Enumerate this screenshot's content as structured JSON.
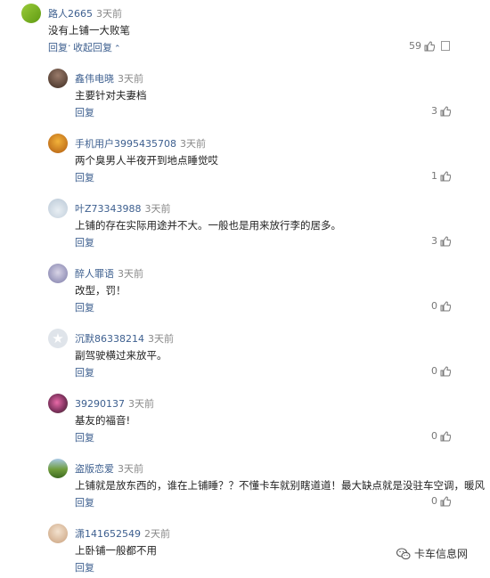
{
  "comments": [
    {
      "user": "路人2665",
      "time": "3天前",
      "text": "没有上铺一大败笔",
      "reply": "回复",
      "sep": "·",
      "collapse": "收起回复",
      "likes": "59"
    },
    {
      "user": "鑫伟电晓",
      "time": "3天前",
      "text": "主要针对夫妻档",
      "reply": "回复",
      "likes": "3"
    },
    {
      "user": "手机用户3995435708",
      "time": "3天前",
      "text": "两个臭男人半夜开到地点睡觉哎",
      "reply": "回复",
      "likes": "1"
    },
    {
      "user": "叶Z73343988",
      "time": "3天前",
      "text": "上铺的存在实际用途并不大。一般也是用来放行李的居多。",
      "reply": "回复",
      "likes": "3"
    },
    {
      "user": "醉人罪语",
      "time": "3天前",
      "text": "改型，罚！",
      "reply": "回复",
      "likes": "0"
    },
    {
      "user": "沉默86338214",
      "time": "3天前",
      "text": "副驾驶横过来放平。",
      "reply": "回复",
      "likes": "0"
    },
    {
      "user": "39290137",
      "time": "3天前",
      "text": "基友的福音!",
      "reply": "回复",
      "likes": "0"
    },
    {
      "user": "盗版恋爱",
      "time": "3天前",
      "text": "上铺就是放东西的，谁在上铺睡？？不懂卡车就别瞎道道！最大缺点就是没驻车空调，暖风",
      "reply": "回复",
      "likes": "0"
    },
    {
      "user": "潇141652549",
      "time": "2天前",
      "text": "上卧铺一般都不用",
      "reply": "回复",
      "likes": "0"
    }
  ],
  "watermark": {
    "text": "卡车信息网"
  },
  "icons": {
    "like": "thumbs-up-icon",
    "report": "report-icon",
    "collapse": "chevron-up-icon",
    "watermark": "wechat-logo-icon"
  }
}
